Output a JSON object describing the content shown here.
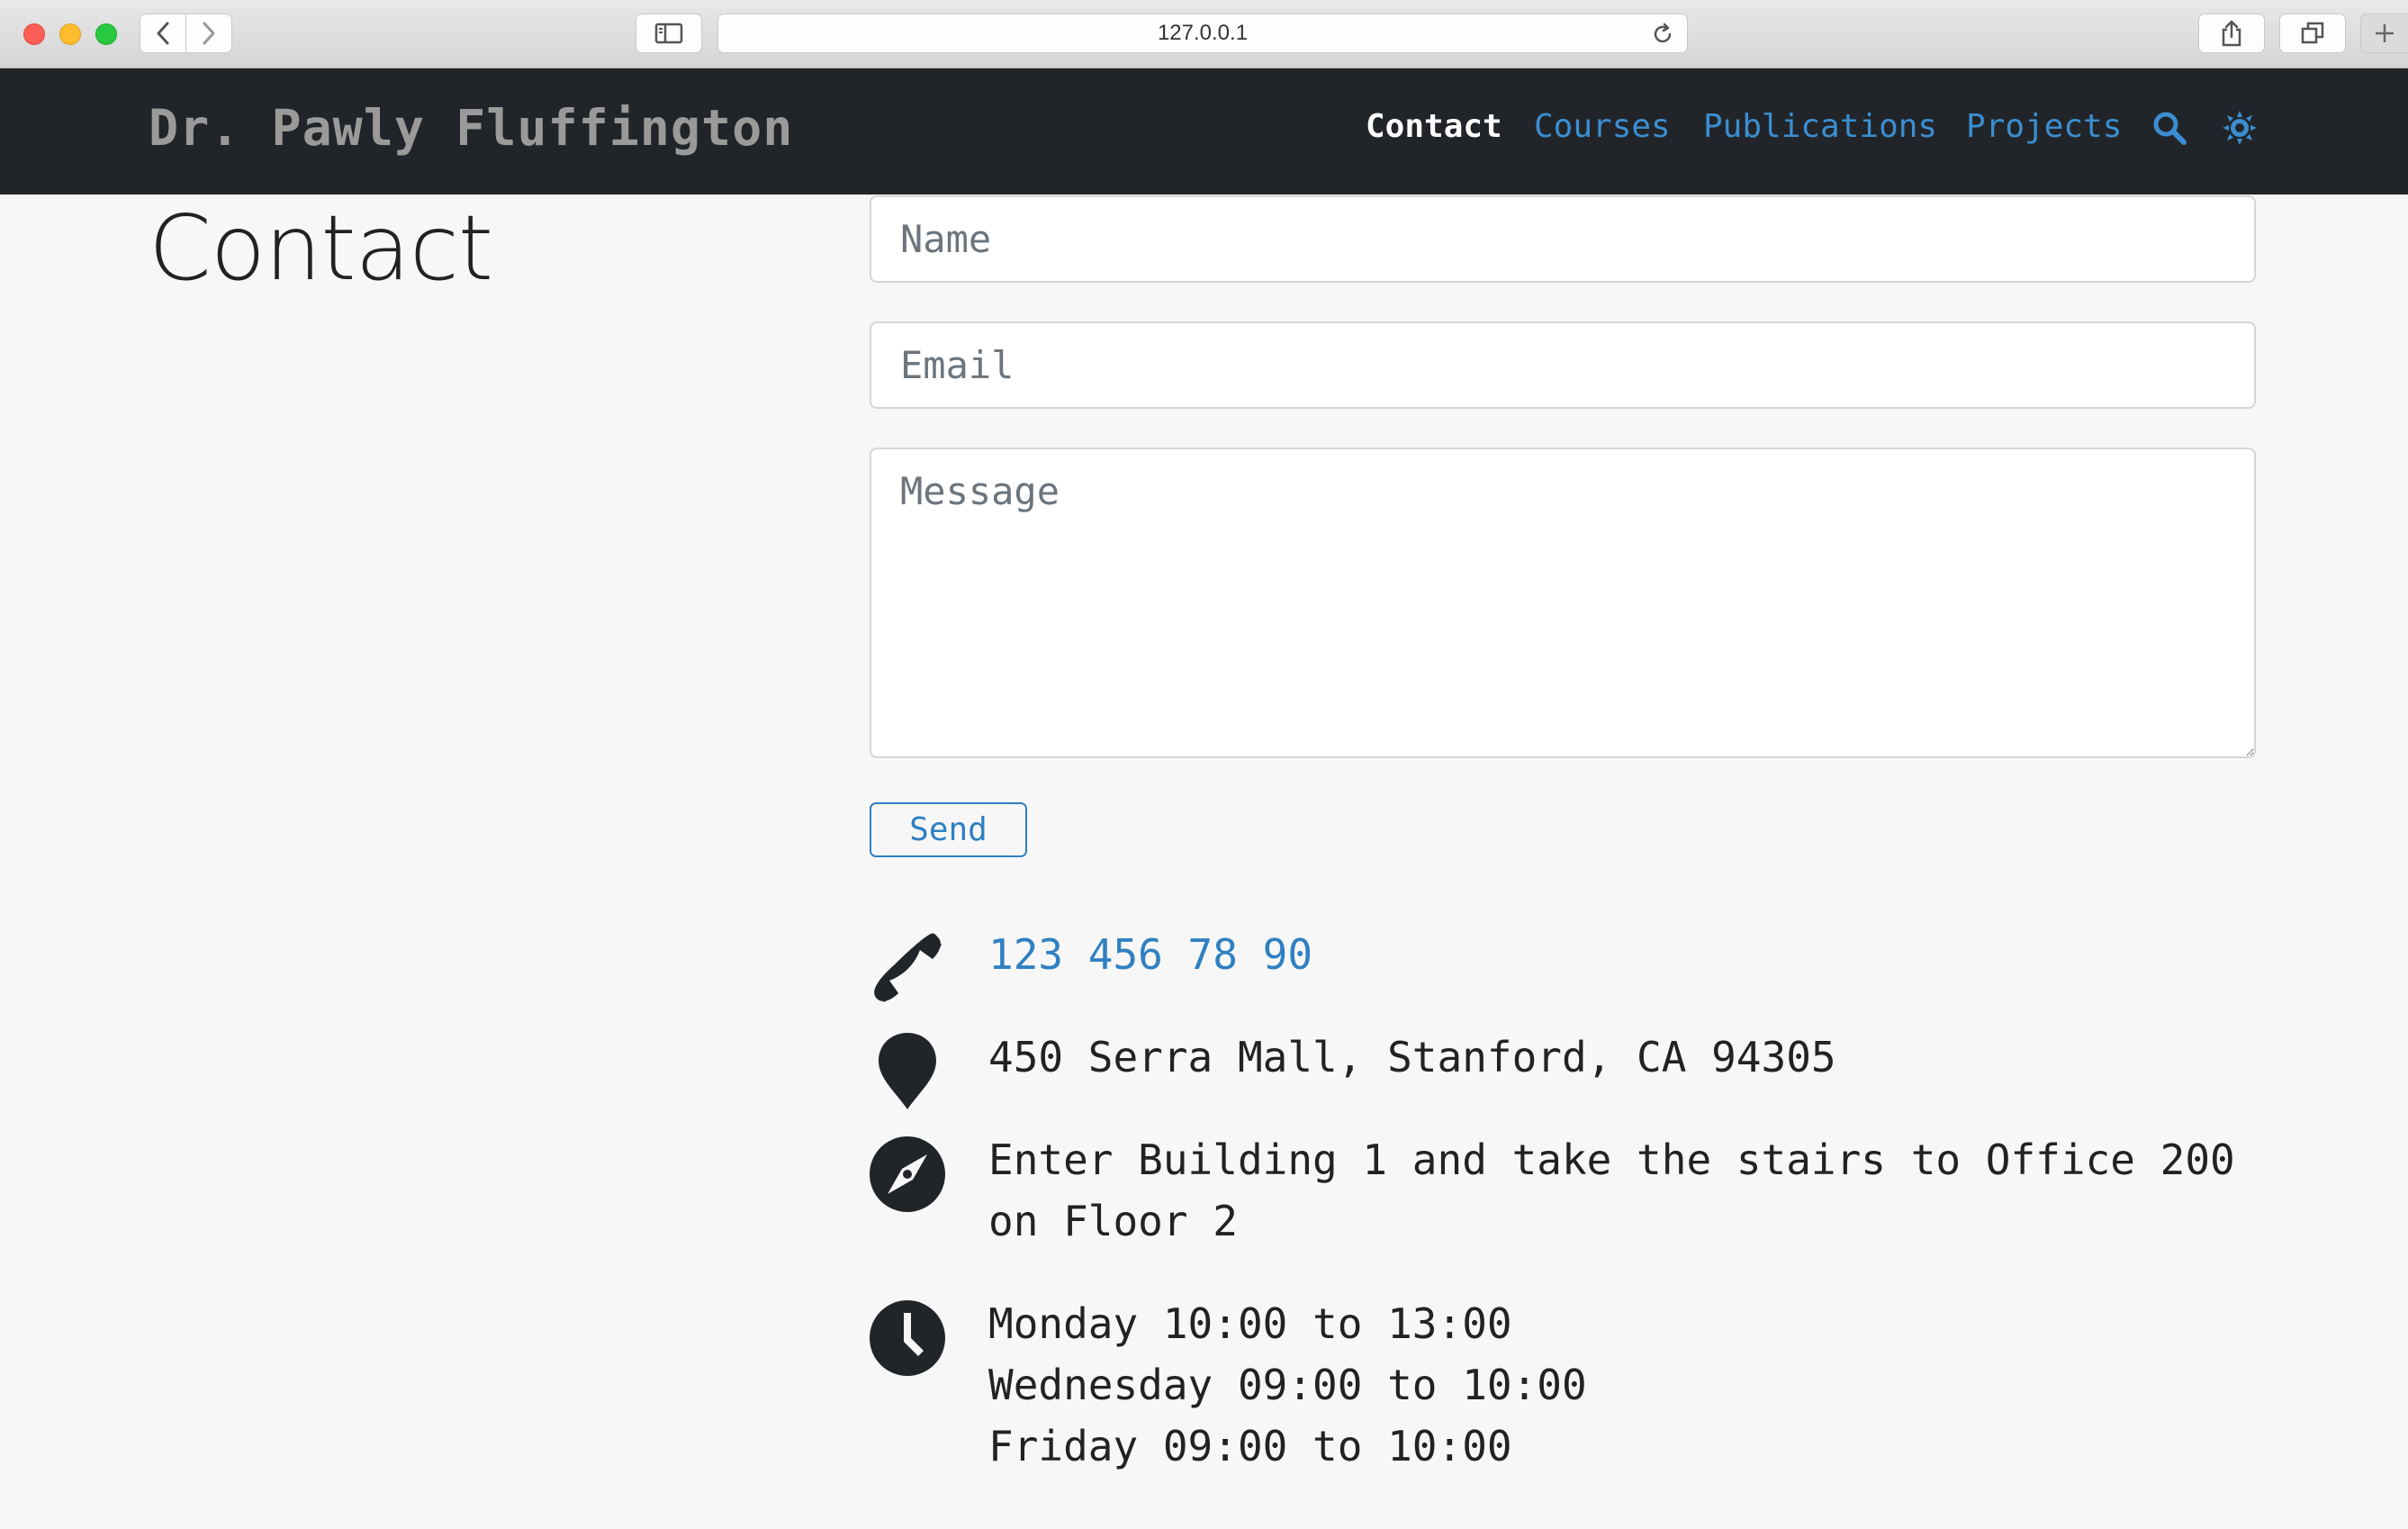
{
  "browser": {
    "url": "127.0.0.1"
  },
  "navbar": {
    "brand": "Dr. Pawly Fluffington",
    "links": [
      {
        "label": "Contact",
        "active": true
      },
      {
        "label": "Courses"
      },
      {
        "label": "Publications"
      },
      {
        "label": "Projects"
      }
    ],
    "icons": [
      "search-icon",
      "theme-toggle-icon"
    ]
  },
  "page": {
    "title": "Contact"
  },
  "form": {
    "name_placeholder": "Name",
    "email_placeholder": "Email",
    "message_placeholder": "Message",
    "send_label": "Send"
  },
  "contact_info": {
    "phone": "123 456 78 90",
    "address": "450 Serra Mall, Stanford, CA 94305",
    "directions": "Enter Building 1 and take the stairs to Office 200\non Floor 2",
    "hours": "Monday 10:00 to 13:00\nWednesday 09:00 to 10:00\nFriday 09:00 to 10:00"
  },
  "colors": {
    "navbar_bg": "#212529",
    "link": "#3b8ed1",
    "page_bg": "#f7f7f7"
  }
}
